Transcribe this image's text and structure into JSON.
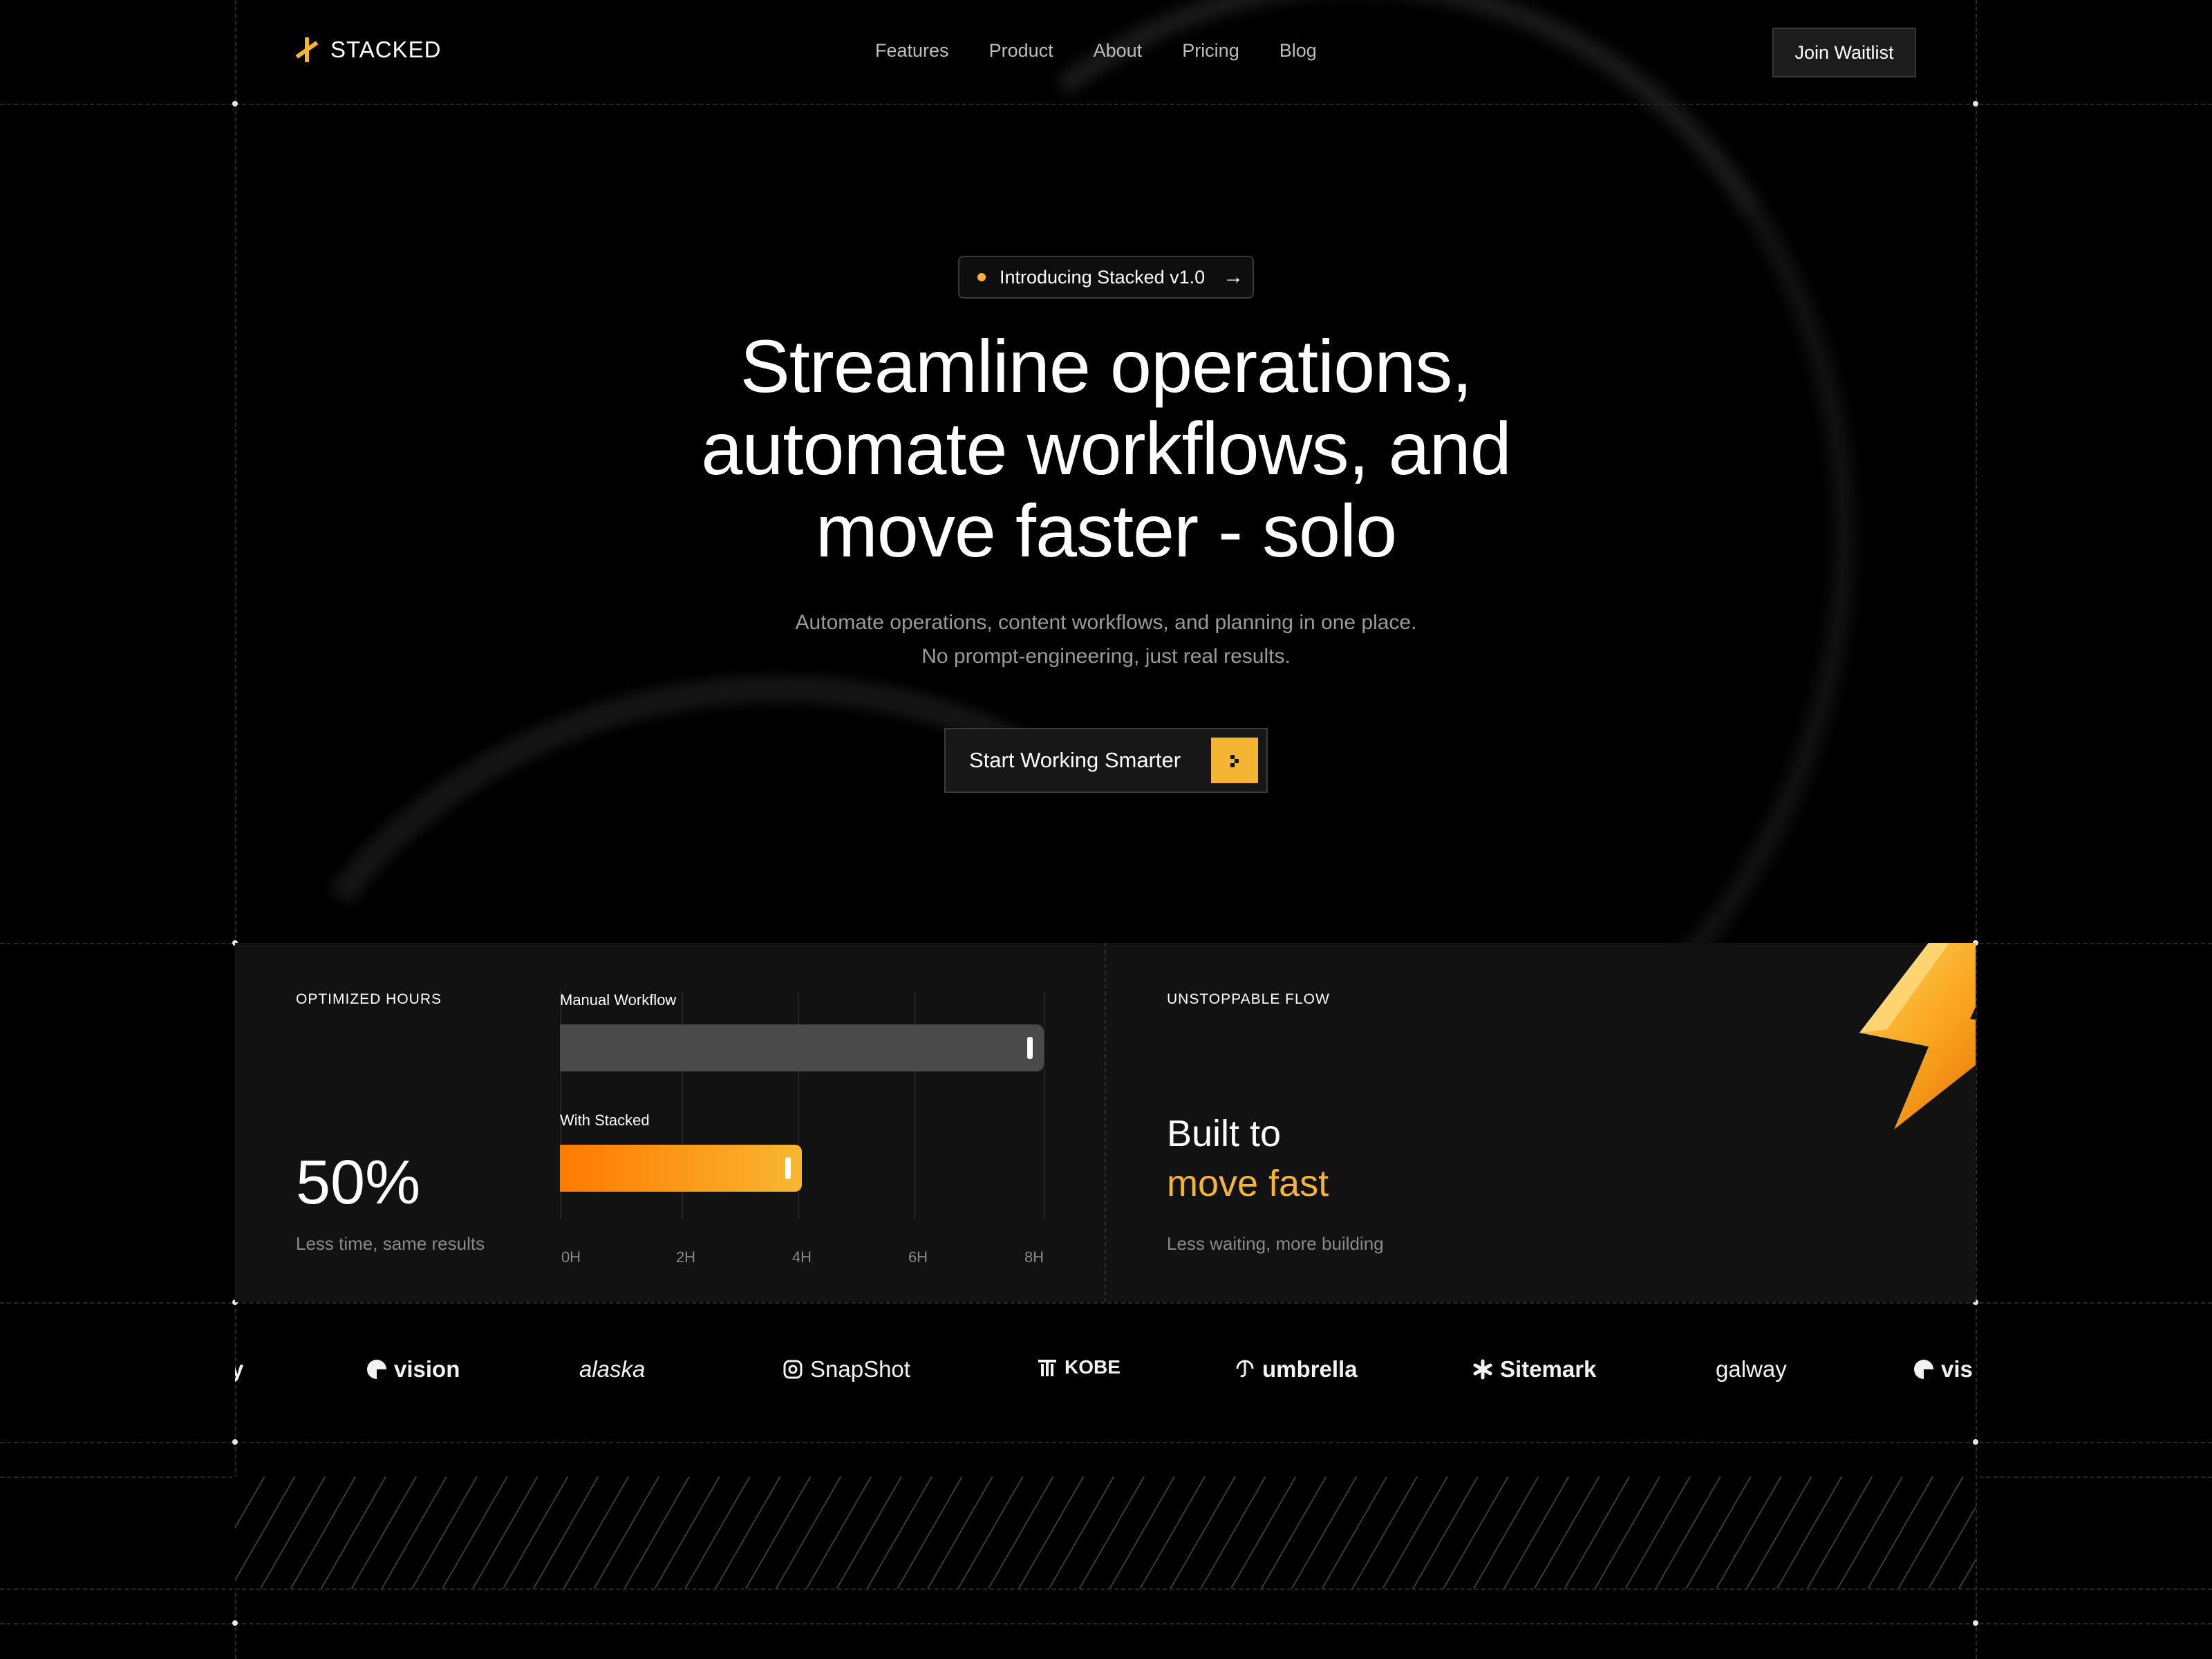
{
  "brand": {
    "name": "STACKED",
    "accent": "#f5b431"
  },
  "nav": {
    "links": [
      "Features",
      "Product",
      "About",
      "Pricing",
      "Blog"
    ],
    "cta": "Join Waitlist"
  },
  "hero": {
    "pill": {
      "text": "Introducing Stacked v1.0",
      "arrow": "→"
    },
    "headline": [
      "Streamline operations,",
      "automate workflows, and",
      "move faster - solo"
    ],
    "subtitle": [
      "Automate operations, content workflows, and planning in one place.",
      "No prompt-engineering, just real results."
    ],
    "cta": "Start Working Smarter"
  },
  "stats": {
    "left": {
      "eyebrow": "OPTIMIZED HOURS",
      "value": "50%",
      "caption": "Less time, same results"
    },
    "chart": {
      "bars": [
        {
          "label": "Manual Workflow",
          "value": 8,
          "color": "#4a4a4a"
        },
        {
          "label": "With Stacked",
          "value": 4,
          "color": "#f5a020"
        }
      ],
      "ticks": [
        "0H",
        "2H",
        "4H",
        "6H",
        "8H"
      ],
      "max": 8
    },
    "right": {
      "eyebrow": "UNSTOPPABLE FLOW",
      "title_line1": "Built to",
      "title_line2": "move fast",
      "caption": "Less waiting, more building",
      "icon": "lightning-bolt-icon"
    }
  },
  "logos": {
    "items": [
      "y",
      "vision",
      "alaska",
      "SnapShot",
      "KOBE",
      "umbrella",
      "Sitemark",
      "galway",
      "vis"
    ]
  }
}
